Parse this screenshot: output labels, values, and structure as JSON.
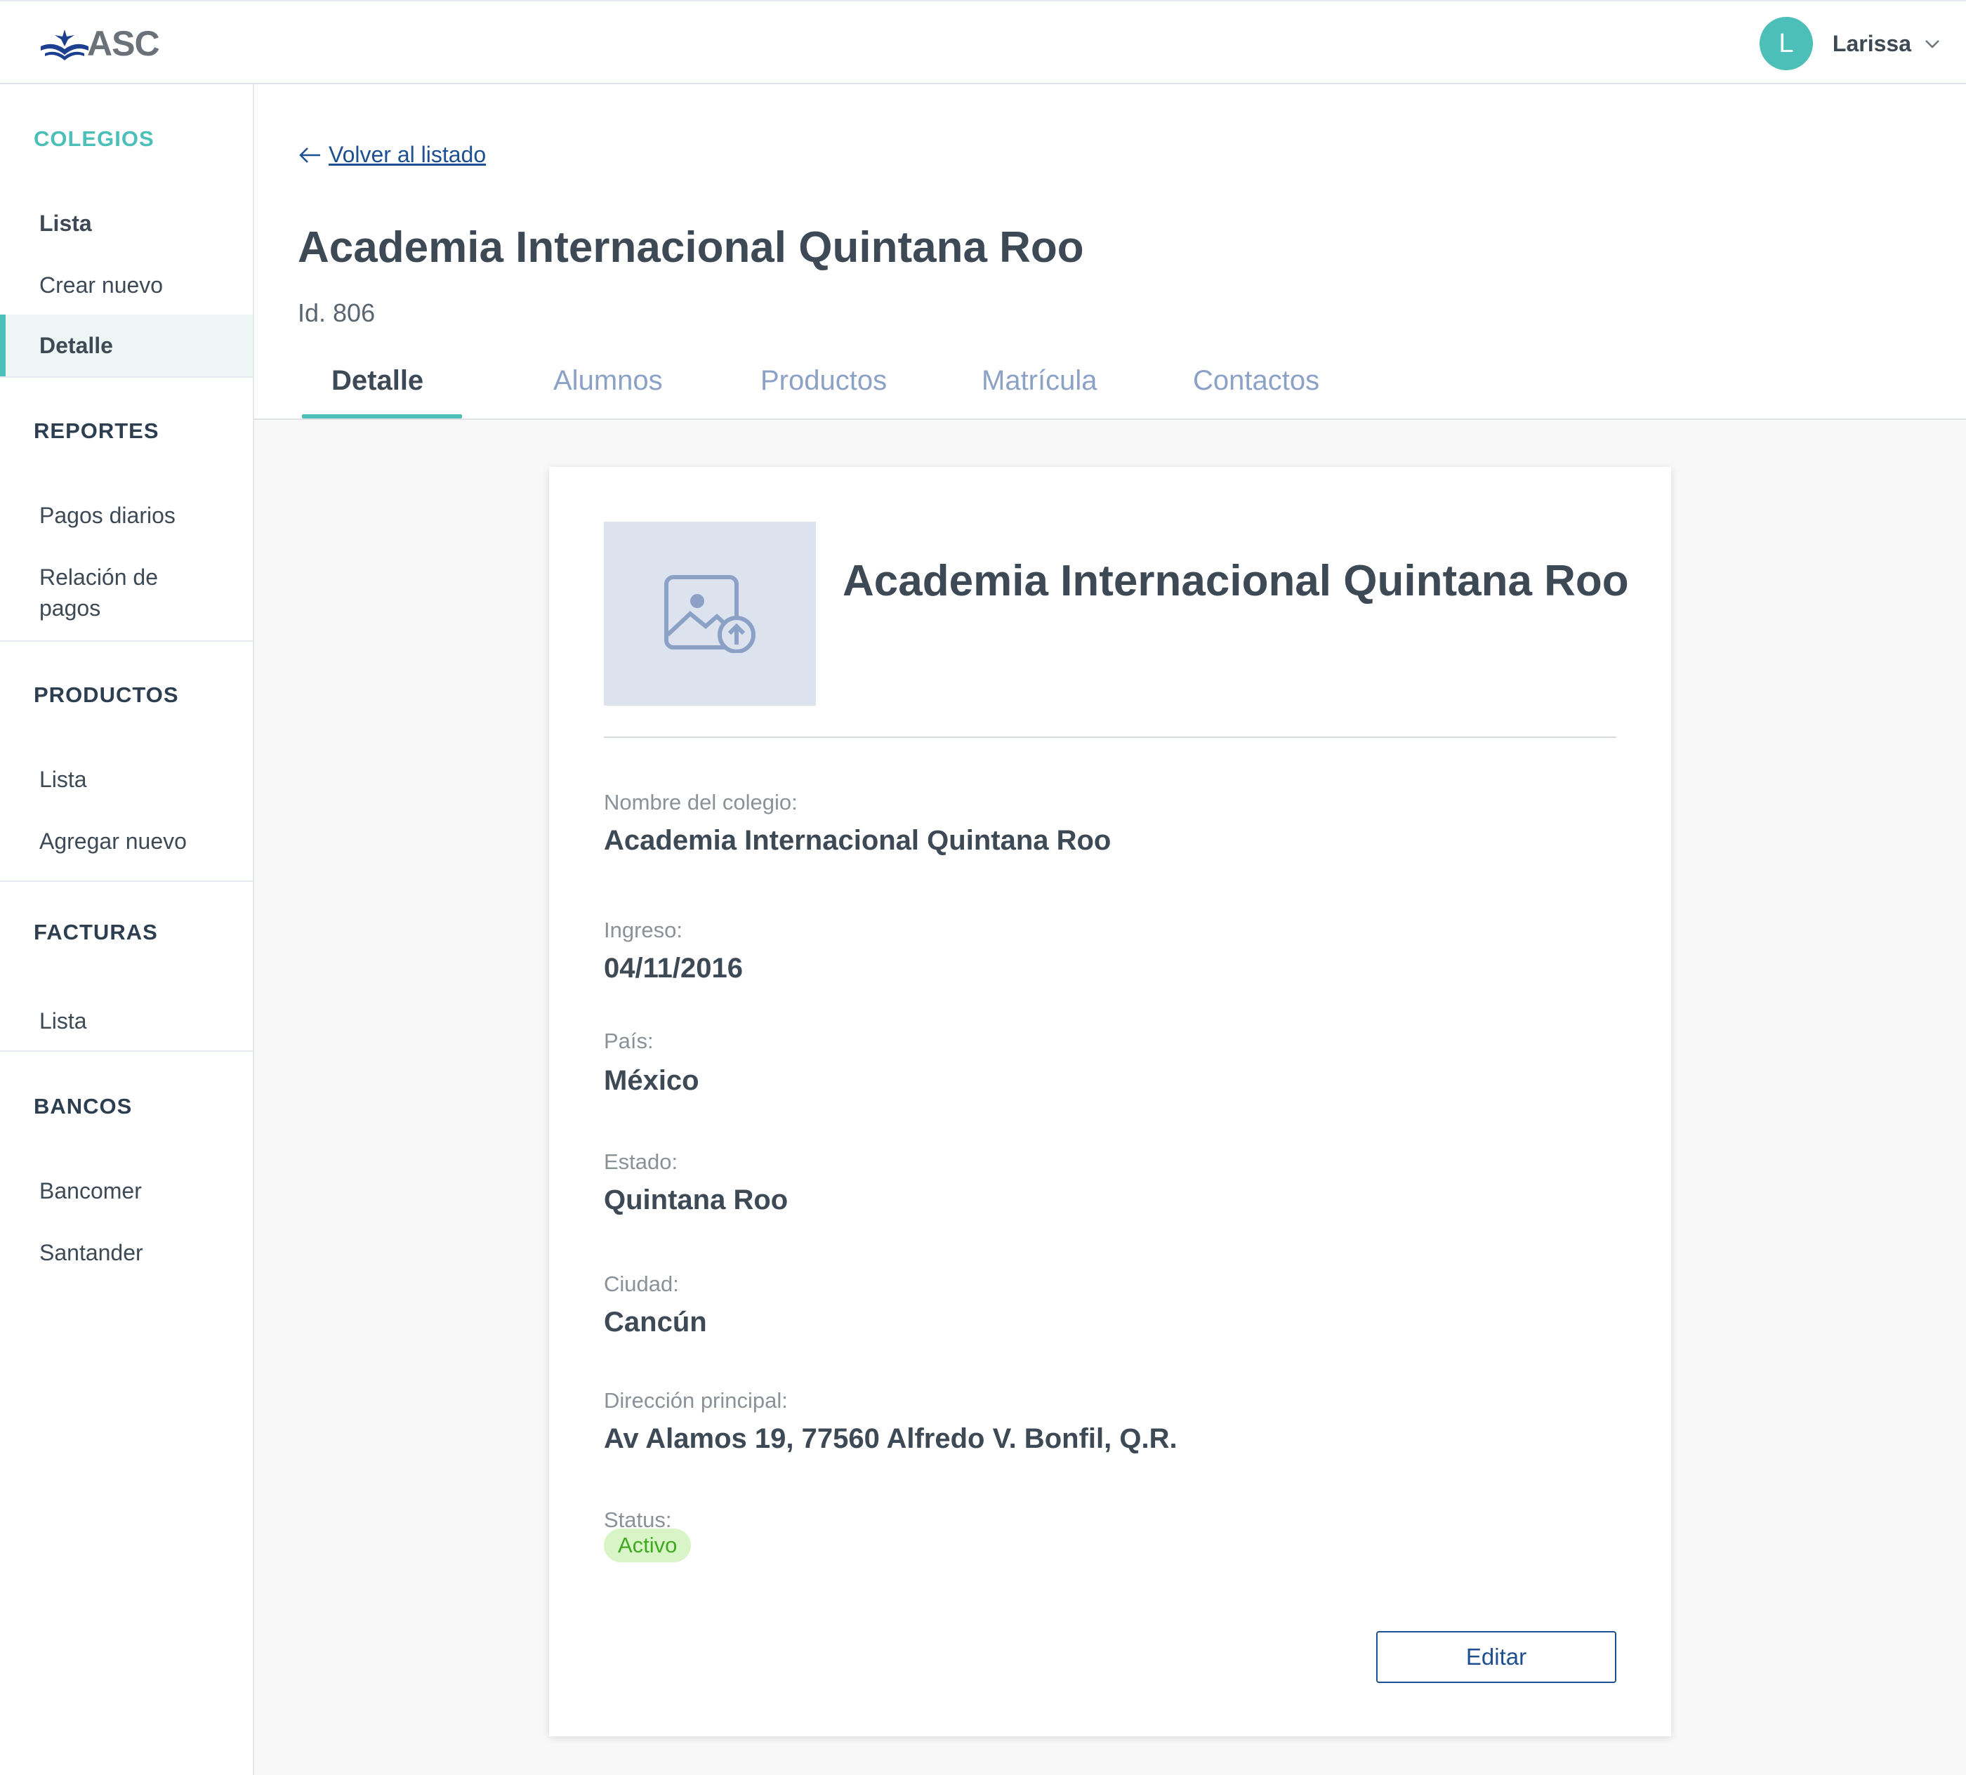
{
  "app": {
    "logo_text": "ASC"
  },
  "user": {
    "initial": "L",
    "name": "Larissa"
  },
  "sidebar": {
    "colegios": {
      "title": "COLEGIOS",
      "items": [
        "Lista",
        "Crear nuevo",
        "Detalle"
      ]
    },
    "reportes": {
      "title": "REPORTES",
      "items": [
        "Pagos diarios",
        "Relación de pagos"
      ]
    },
    "productos": {
      "title": "PRODUCTOS",
      "items": [
        "Lista",
        "Agregar nuevo"
      ]
    },
    "facturas": {
      "title": "FACTURAS",
      "items": [
        "Lista"
      ]
    },
    "bancos": {
      "title": "BANCOS",
      "items": [
        "Bancomer",
        "Santander"
      ]
    }
  },
  "header": {
    "back_link": "Volver al listado",
    "title": "Academia Internacional Quintana Roo",
    "id_text": "Id. 806",
    "tabs": [
      "Detalle",
      "Alumnos",
      "Productos",
      "Matrícula",
      "Contactos"
    ]
  },
  "card": {
    "title": "Academia Internacional Quintana Roo",
    "fields": [
      {
        "label": "Nombre del colegio:",
        "value": "Academia Internacional Quintana Roo"
      },
      {
        "label": "Ingreso:",
        "value": "04/11/2016"
      },
      {
        "label": "País:",
        "value": "México"
      },
      {
        "label": "Estado:",
        "value": "Quintana Roo"
      },
      {
        "label": "Ciudad:",
        "value": "Cancún"
      },
      {
        "label": "Dirección principal:",
        "value": "Av Alamos 19, 77560 Alfredo V. Bonfil, Q.R."
      }
    ],
    "status_label": "Status:",
    "status_value": "Activo",
    "edit_button": "Editar"
  },
  "colors": {
    "accent": "#4cc0b8",
    "link": "#1d4f91",
    "tab_inactive": "#8ba2c6",
    "status_bg": "#d9f5c8",
    "status_text": "#3faa1f"
  }
}
